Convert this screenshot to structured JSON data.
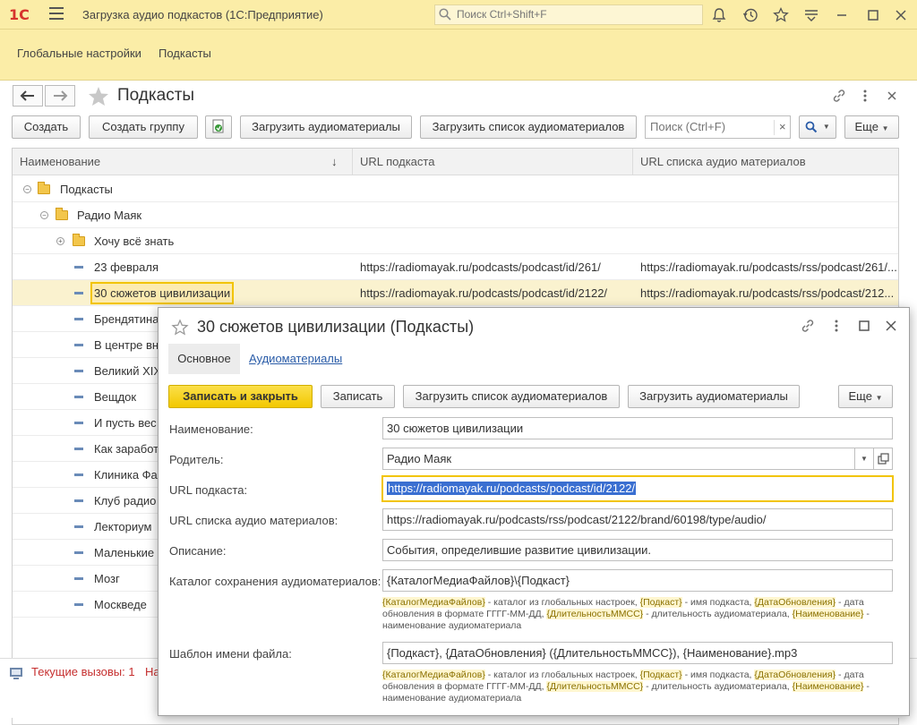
{
  "titlebar": {
    "logo": "1С",
    "title": "Загрузка аудио подкастов  (1С:Предприятие)",
    "search_placeholder": "Поиск Ctrl+Shift+F"
  },
  "sections": {
    "items": [
      "Глобальные настройки",
      "Подкасты"
    ]
  },
  "main": {
    "title": "Подкасты",
    "toolbar": {
      "create": "Создать",
      "create_group": "Создать группу",
      "load_audio": "Загрузить аудиоматериалы",
      "load_list": "Загрузить список аудиоматериалов",
      "search_placeholder": "Поиск (Ctrl+F)",
      "more": "Еще"
    },
    "columns": {
      "name": "Наименование",
      "url": "URL подкаста",
      "url_list": "URL списка аудио материалов"
    },
    "rows": [
      {
        "name": "Подкасты",
        "url": "",
        "url_list": ""
      },
      {
        "name": "Радио Маяк",
        "url": "",
        "url_list": ""
      },
      {
        "name": "Хочу всё знать",
        "url": "",
        "url_list": ""
      },
      {
        "name": "23 февраля",
        "url": "https://radiomayak.ru/podcasts/podcast/id/261/",
        "url_list": "https://radiomayak.ru/podcasts/rss/podcast/261/..."
      },
      {
        "name": "30 сюжетов цивилизации",
        "url": "https://radiomayak.ru/podcasts/podcast/id/2122/",
        "url_list": "https://radiomayak.ru/podcasts/rss/podcast/212..."
      },
      {
        "name": "Брендятина"
      },
      {
        "name": "В центре вн"
      },
      {
        "name": "Великий XIX"
      },
      {
        "name": "Вещдок"
      },
      {
        "name": "И пусть вес"
      },
      {
        "name": "Как заработ"
      },
      {
        "name": "Клиника Фа"
      },
      {
        "name": "Клуб радио"
      },
      {
        "name": "Лекториум"
      },
      {
        "name": "Маленькие"
      },
      {
        "name": "Мозг"
      },
      {
        "name": "Москведе"
      }
    ]
  },
  "status": {
    "calls": "Текущие вызовы: 1",
    "calls_cut": "На"
  },
  "dialog": {
    "title": "30 сюжетов цивилизации (Подкасты)",
    "tabs": [
      "Основное",
      "Аудиоматериалы"
    ],
    "buttons": {
      "save_close": "Записать и закрыть",
      "save": "Записать",
      "load_list": "Загрузить список аудиоматериалов",
      "load_audio": "Загрузить аудиоматериалы",
      "more": "Еще"
    },
    "fields": {
      "name_label": "Наименование:",
      "name_value": "30 сюжетов цивилизации",
      "parent_label": "Родитель:",
      "parent_value": "Радио Маяк",
      "url_label": "URL подкаста:",
      "url_value": "https://radiomayak.ru/podcasts/podcast/id/2122/",
      "url_list_label": "URL списка аудио материалов:",
      "url_list_value": "https://radiomayak.ru/podcasts/rss/podcast/2122/brand/60198/type/audio/",
      "desc_label": "Описание:",
      "desc_value": "События, определившие развитие цивилизации.",
      "catalog_label": "Каталог сохранения аудиоматериалов:",
      "catalog_value": "{КаталогМедиаФайлов}\\{Подкаст}",
      "template_label": "Шаблон имени файла:",
      "template_value": "{Подкаст}, {ДатаОбновления} ({ДлительностьММСС}), {Наименование}.mp3"
    },
    "hint": {
      "t1": "{КаталогМедиаФайлов}",
      "s1": " - каталог из глобальных настроек, ",
      "t2": "{Подкаст}",
      "s2": " - имя подкаста, ",
      "t3": "{ДатаОбновления}",
      "s3": " - дата обновления в формате ГГГГ-ММ-ДД, ",
      "t4": "{ДлительностьММСС}",
      "s4": " - длительность аудиоматериала, ",
      "t5": "{Наименование}",
      "s5": " - наименование аудиоматериала"
    }
  }
}
